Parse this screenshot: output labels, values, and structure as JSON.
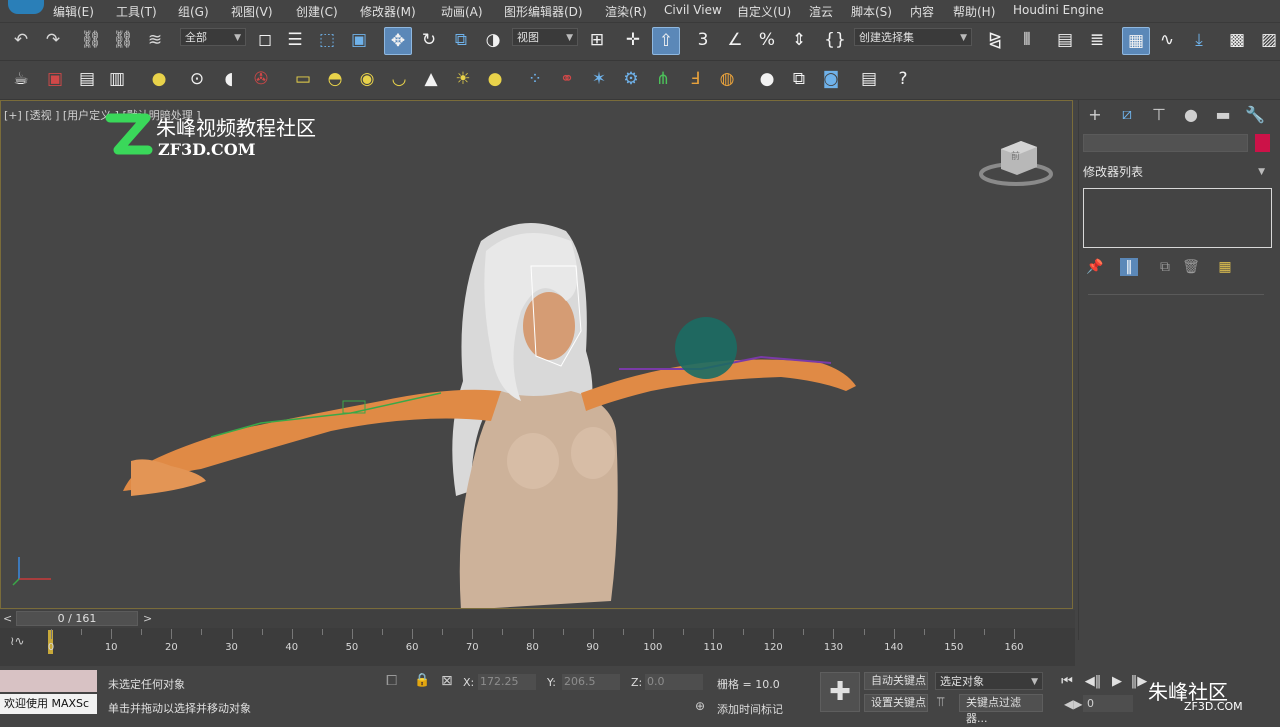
{
  "menubar": {
    "items": [
      "编辑(E)",
      "工具(T)",
      "组(G)",
      "视图(V)",
      "创建(C)",
      "修改器(M)",
      "动画(A)",
      "图形编辑器(D)",
      "渲染(R)",
      "Civil View",
      "自定义(U)",
      "渲云",
      "脚本(S)",
      "内容",
      "帮助(H)",
      "Houdini Engine"
    ]
  },
  "main_toolbar": {
    "selection_filter": "全部",
    "ref_coord": "视图",
    "named_selection": "创建选择集"
  },
  "viewport": {
    "label": "[+] [透视 ] [用户定义 ] [默认明暗处理 ]",
    "watermark_title": "朱峰视频教程社区",
    "watermark_sub": "ZF3D.COM",
    "viewcube_label": "前"
  },
  "command_panel": {
    "modifier_list_label": "修改器列表",
    "object_color": "#cc1248"
  },
  "timeline": {
    "frame_display": "0 / 161",
    "prev": "<",
    "next": ">",
    "ticks": [
      "0",
      "10",
      "20",
      "30",
      "40",
      "50",
      "60",
      "70",
      "80",
      "90",
      "100",
      "110",
      "120",
      "130",
      "140",
      "150",
      "160"
    ]
  },
  "status": {
    "maxscript_label": "欢迎使用 MAXSc",
    "selection_status": "未选定任何对象",
    "prompt": "单击并拖动以选择并移动对象",
    "x_label": "X:",
    "x_value": "172.25",
    "y_label": "Y:",
    "y_value": "206.5",
    "z_label": "Z:",
    "z_value": "0.0",
    "grid": "栅格 = 10.0",
    "add_time_tag": "添加时间标记",
    "auto_key": "自动关键点",
    "set_key": "设置关键点",
    "selected_object": "选定对象",
    "key_filters": "关键点过滤器...",
    "current_frame": "0"
  },
  "brand": {
    "title": "朱峰社区",
    "sub": "ZF3D.COM"
  }
}
